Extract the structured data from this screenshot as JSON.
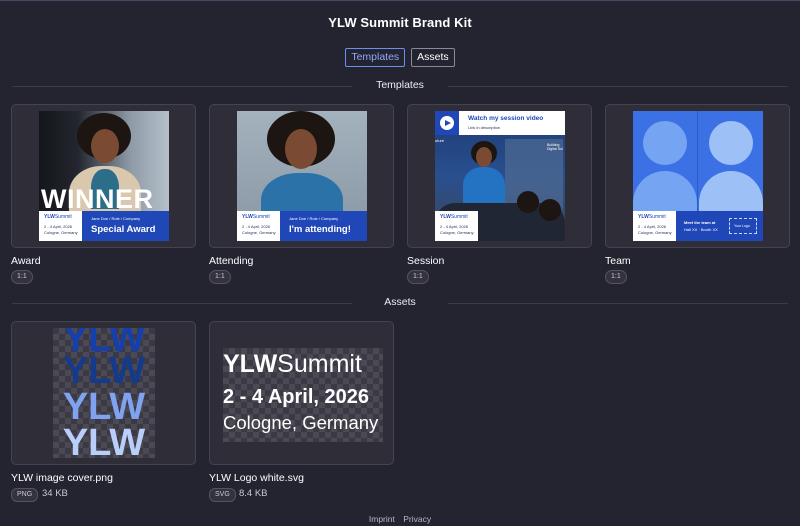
{
  "header": {
    "title": "YLW Summit Brand Kit"
  },
  "tabs": [
    {
      "label": "Templates",
      "active": true
    },
    {
      "label": "Assets",
      "active": false
    }
  ],
  "sections": {
    "templates": "Templates",
    "assets": "Assets"
  },
  "templates": [
    {
      "name": "Award",
      "ratio": "1:1",
      "overlay_text": "WINNER",
      "role_line": "Jane Doe / Role / Company",
      "headline": "Special Award"
    },
    {
      "name": "Attending",
      "ratio": "1:1",
      "role_line": "Jane Doe / Role / Company",
      "headline": "I'm attending!"
    },
    {
      "name": "Session",
      "ratio": "1:1",
      "video_title": "Watch my session video",
      "video_sub": "Link in description",
      "side_text": "Building Digital Sol",
      "left_text": "uture"
    },
    {
      "name": "Team",
      "ratio": "1:1",
      "meet_line": "Meet the team at",
      "hall_line": "Hall XX · Booth XX",
      "logo_box": "Your Logo"
    }
  ],
  "brand_mini": {
    "logo_bold": "YLW",
    "logo_light": "Summit",
    "dates": "2 - 4 April, 2026",
    "city": "Cologne, Germany"
  },
  "assets": [
    {
      "name": "YLW image cover.png",
      "type": "PNG",
      "size": "34 KB",
      "cover_word": "YLW"
    },
    {
      "name": "YLW Logo white.svg",
      "type": "SVG",
      "size": "8.4 KB",
      "logo_bold": "YLW",
      "logo_light": "Summit",
      "dates": "2 - 4 April, 2026",
      "city": "Cologne, Germany"
    }
  ],
  "footer": {
    "imprint": "Imprint",
    "privacy": "Privacy"
  },
  "colors": {
    "background": "#242330",
    "accent": "#6d8df0",
    "brand_blue": "#1f47b8"
  }
}
